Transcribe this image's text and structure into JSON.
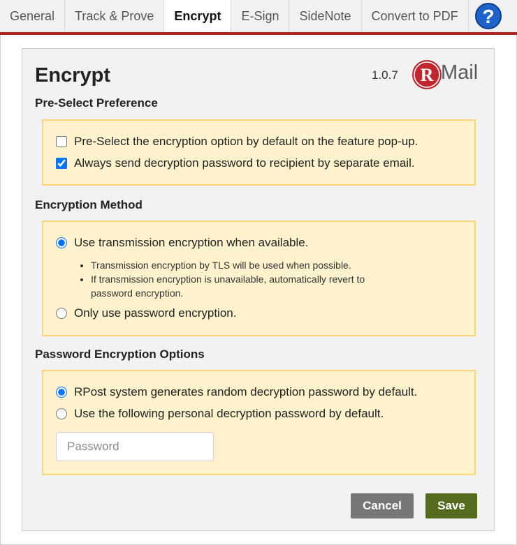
{
  "tabs": [
    {
      "label": "General"
    },
    {
      "label": "Track & Prove"
    },
    {
      "label": "Encrypt"
    },
    {
      "label": "E-Sign"
    },
    {
      "label": "SideNote"
    },
    {
      "label": "Convert to PDF"
    }
  ],
  "active_tab": "Encrypt",
  "help": {
    "icon": "question-mark-icon",
    "glyph": "?",
    "color": "#1f62c9"
  },
  "header": {
    "title": "Encrypt",
    "version": "1.0.7"
  },
  "logo": {
    "letter": "R",
    "text": "Mail",
    "color": "#c0262d"
  },
  "preselect": {
    "heading": "Pre-Select Preference",
    "options": [
      {
        "label": "Pre-Select the encryption option by default on the feature pop-up.",
        "checked": false
      },
      {
        "label": "Always send decryption password to recipient by separate email.",
        "checked": true
      }
    ]
  },
  "method": {
    "heading": "Encryption Method",
    "option1": {
      "label": "Use transmission encryption when available.",
      "selected": true
    },
    "bullets": [
      "Transmission encryption by TLS will be used when possible.",
      "If transmission encryption is unavailable, automatically revert to password encryption."
    ],
    "option2": {
      "label": "Only use password encryption.",
      "selected": false
    }
  },
  "password_options": {
    "heading": "Password Encryption Options",
    "option1": {
      "label": "RPost system generates random decryption password by default.",
      "selected": true
    },
    "option2": {
      "label": "Use the following personal decryption password by default.",
      "selected": false
    },
    "password_placeholder": "Password",
    "password_value": ""
  },
  "actions": {
    "cancel_label": "Cancel",
    "save_label": "Save"
  },
  "colors": {
    "accent_bar": "#b32323",
    "option_box": "#fff2cc",
    "save": "#556b1e",
    "cancel": "#777777"
  }
}
